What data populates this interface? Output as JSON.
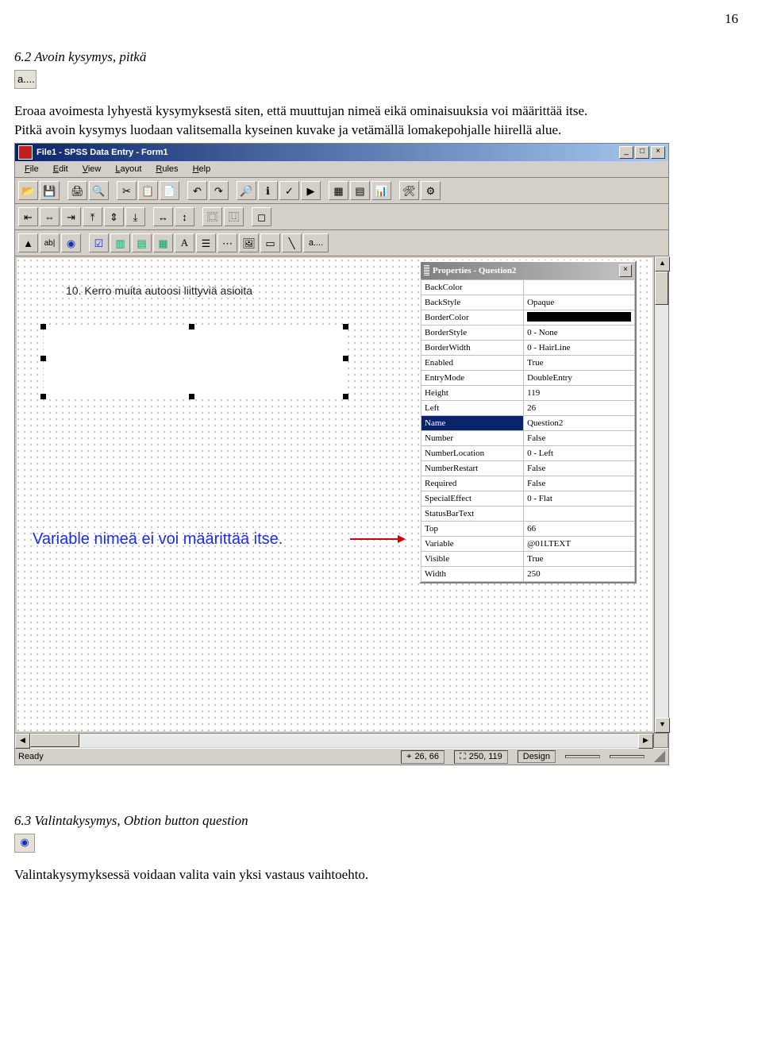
{
  "page_number": "16",
  "section1_title": "6.2 Avoin kysymys, pitkä",
  "icon_a_label": "a....",
  "para1": "Eroaa avoimesta lyhyestä kysymyksestä siten, että muuttujan nimeä eikä ominaisuuksia voi  määrittää itse.",
  "para2": "Pitkä avoin kysymys luodaan valitsemalla kyseinen kuvake ja vetämällä lomakepohjalle hiirellä alue.",
  "window": {
    "title": "File1 - SPSS Data Entry - Form1",
    "menus": [
      "File",
      "Edit",
      "View",
      "Layout",
      "Rules",
      "Help"
    ],
    "form_label": "10. Kerro muita autoosi liittyviä asioita",
    "annotation": "Variable nimeä ei voi määrittää itse.",
    "properties_title": "Properties - Question2",
    "properties": [
      {
        "k": "BackColor",
        "v": "",
        "swatch": "white"
      },
      {
        "k": "BackStyle",
        "v": "Opaque"
      },
      {
        "k": "BorderColor",
        "v": "",
        "swatch": "black"
      },
      {
        "k": "BorderStyle",
        "v": "0 - None"
      },
      {
        "k": "BorderWidth",
        "v": "0 - HairLine"
      },
      {
        "k": "Enabled",
        "v": "True"
      },
      {
        "k": "EntryMode",
        "v": "DoubleEntry"
      },
      {
        "k": "Height",
        "v": "119"
      },
      {
        "k": "Left",
        "v": "26"
      },
      {
        "k": "Name",
        "v": "Question2",
        "selected": true
      },
      {
        "k": "Number",
        "v": "False"
      },
      {
        "k": "NumberLocation",
        "v": "0 - Left"
      },
      {
        "k": "NumberRestart",
        "v": "False"
      },
      {
        "k": "Required",
        "v": "False"
      },
      {
        "k": "SpecialEffect",
        "v": "0 - Flat"
      },
      {
        "k": "StatusBarText",
        "v": ""
      },
      {
        "k": "Top",
        "v": "66"
      },
      {
        "k": "Variable",
        "v": "@01LTEXT"
      },
      {
        "k": "Visible",
        "v": "True"
      },
      {
        "k": "Width",
        "v": "250"
      }
    ],
    "status_ready": "Ready",
    "status_pos": "26, 66",
    "status_size": "250, 119",
    "status_mode": "Design"
  },
  "section2_title": "6.3 Valintakysymys, Obtion button question",
  "para3": "Valintakysymyksessä voidaan valita vain yksi vastaus vaihtoehto."
}
